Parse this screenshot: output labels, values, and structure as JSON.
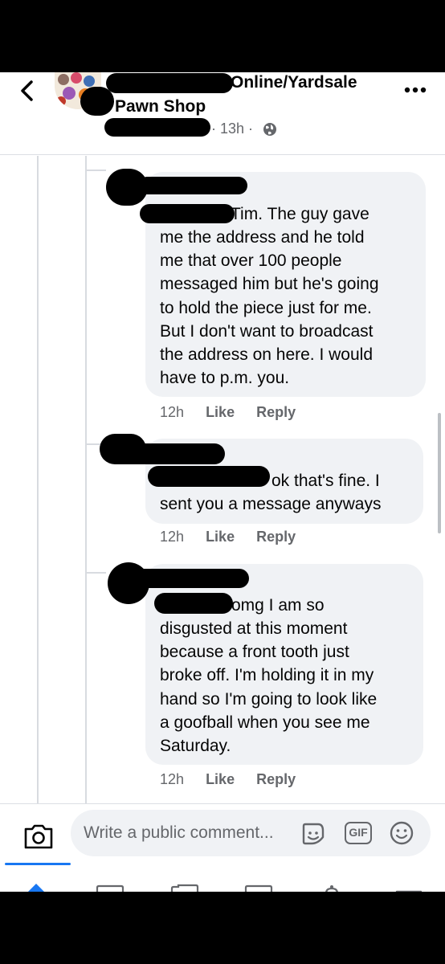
{
  "header": {
    "back_icon": "chevron-left-icon",
    "group_name_suffix": "Online/Yardsale",
    "group_name_line2": "Pawn Shop",
    "time": "· 13h ·",
    "privacy_icon": "globe-icon",
    "more_icon": "more-dots-icon"
  },
  "comments": [
    {
      "name_fragment": "Tim. The guy gave",
      "lines": [
        "me the address and he told",
        "me that over 100 people",
        "messaged him but he's going",
        "to hold the piece just for me.",
        "But I don't want to broadcast",
        "the address on here. I would",
        "have to p.m. you."
      ],
      "time": "12h",
      "like": "Like",
      "reply": "Reply"
    },
    {
      "name_fragment": "ok that's fine. I",
      "lines": [
        "sent you a message anyways"
      ],
      "time": "12h",
      "like": "Like",
      "reply": "Reply"
    },
    {
      "name_fragment": "omg I am so",
      "lines": [
        "disgusted at this moment",
        "because a front tooth just",
        "broke off. I'm holding it in my",
        "hand so I'm going to look like",
        "a goofball when you see me",
        "Saturday."
      ],
      "time": "12h",
      "like": "Like",
      "reply": "Reply"
    }
  ],
  "composer": {
    "camera_icon": "camera-icon",
    "placeholder": "Write a public comment...",
    "sticker_icon": "sticker-icon",
    "gif_label": "GIF",
    "emoji_icon": "emoji-icon"
  },
  "tabbar": {
    "icons": [
      "home-icon",
      "video-icon",
      "marketplace-icon",
      "news-icon",
      "notifications-icon",
      "menu-icon"
    ]
  }
}
